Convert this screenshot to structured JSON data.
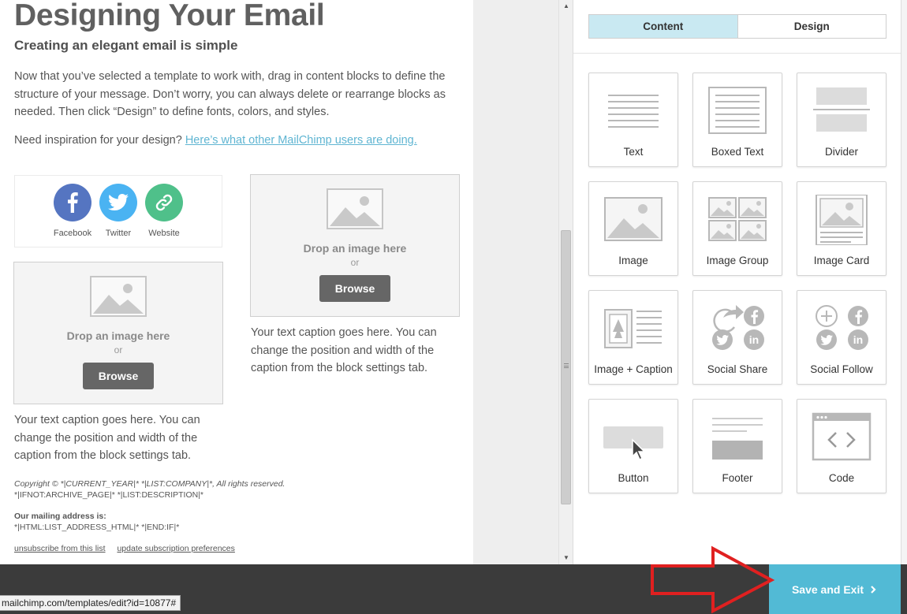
{
  "email": {
    "title": "Designing Your Email",
    "subtitle": "Creating an elegant email is simple",
    "intro": "Now that you’ve selected a template to work with, drag in content blocks to define the structure of your message. Don’t worry, you can always delete or rearrange blocks as needed. Then click “Design” to define fonts, colors, and styles.",
    "inspiration_prefix": "Need inspiration for your design?",
    "inspiration_link": "Here’s what other MailChimp users are doing.",
    "social": [
      {
        "label": "Facebook",
        "icon": "facebook-icon",
        "color": "#5575c1"
      },
      {
        "label": "Twitter",
        "icon": "twitter-icon",
        "color": "#4ab3f2"
      },
      {
        "label": "Website",
        "icon": "link-icon",
        "color": "#4fc08a"
      }
    ],
    "image_block_1": {
      "drop_text": "Drop an image here",
      "or_text": "or",
      "browse_label": "Browse"
    },
    "image_block_2": {
      "drop_text": "Drop an image here",
      "or_text": "or",
      "browse_label": "Browse"
    },
    "caption_1": "Your text caption goes here. You can change the position and width of the caption from the block settings tab.",
    "caption_2": "Your text caption goes here. You can change the position and width of the caption from the block settings tab.",
    "copyright": "Copyright © *|CURRENT_YEAR|* *|LIST:COMPANY|*, All rights reserved.",
    "archive_tags": "*|IFNOT:ARCHIVE_PAGE|* *|LIST:DESCRIPTION|*",
    "mailing_heading": "Our mailing address is:",
    "mailing_tags": "*|HTML:LIST_ADDRESS_HTML|* *|END:IF|*",
    "unsubscribe_link": "unsubscribe from this list",
    "update_link": "update subscription preferences"
  },
  "panel": {
    "tabs": {
      "content": "Content",
      "design": "Design"
    },
    "blocks": [
      {
        "label": "Text",
        "icon": "text-block-icon"
      },
      {
        "label": "Boxed Text",
        "icon": "boxed-text-block-icon"
      },
      {
        "label": "Divider",
        "icon": "divider-block-icon"
      },
      {
        "label": "Image",
        "icon": "image-block-icon"
      },
      {
        "label": "Image Group",
        "icon": "image-group-block-icon"
      },
      {
        "label": "Image Card",
        "icon": "image-card-block-icon"
      },
      {
        "label": "Image + Caption",
        "icon": "image-caption-block-icon"
      },
      {
        "label": "Social Share",
        "icon": "social-share-block-icon"
      },
      {
        "label": "Social Follow",
        "icon": "social-follow-block-icon"
      },
      {
        "label": "Button",
        "icon": "button-block-icon"
      },
      {
        "label": "Footer",
        "icon": "footer-block-icon"
      },
      {
        "label": "Code",
        "icon": "code-block-icon"
      }
    ]
  },
  "footer": {
    "save_exit_label": "Save and Exit",
    "save_exit_icon": "chevron-right-icon",
    "status_url": "mailchimp.com/templates/edit?id=10877#"
  },
  "colors": {
    "accent": "#52bad5",
    "link": "#5fb5d2",
    "annotation_arrow": "#e02020"
  }
}
